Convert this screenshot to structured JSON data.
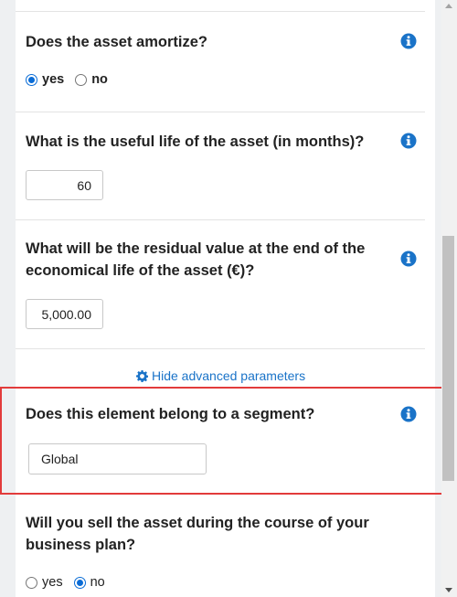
{
  "colors": {
    "accent": "#1a73c8",
    "highlight_border": "#e23b3b",
    "radio_checked": "#0a6cd6"
  },
  "sections": {
    "amortize": {
      "question": "Does the asset amortize?",
      "icon": "info-icon",
      "options": [
        "yes",
        "no"
      ],
      "selected": "yes"
    },
    "useful_life": {
      "question": "What is the useful life of the asset (in months)?",
      "icon": "info-icon",
      "value": "60"
    },
    "residual_value": {
      "question": "What will be the residual value at the end of the economical life of the asset (€)?",
      "icon": "info-icon",
      "value": "5,000.00"
    },
    "advanced": {
      "link_label": "Hide advanced parameters",
      "icon": "gear-icon"
    },
    "segment": {
      "question": "Does this element belong to a segment?",
      "icon": "info-icon",
      "value": "Global"
    },
    "sell_asset": {
      "question": "Will you sell the asset during the course of your business plan?",
      "options": [
        "yes",
        "no"
      ],
      "selected": "no"
    }
  }
}
